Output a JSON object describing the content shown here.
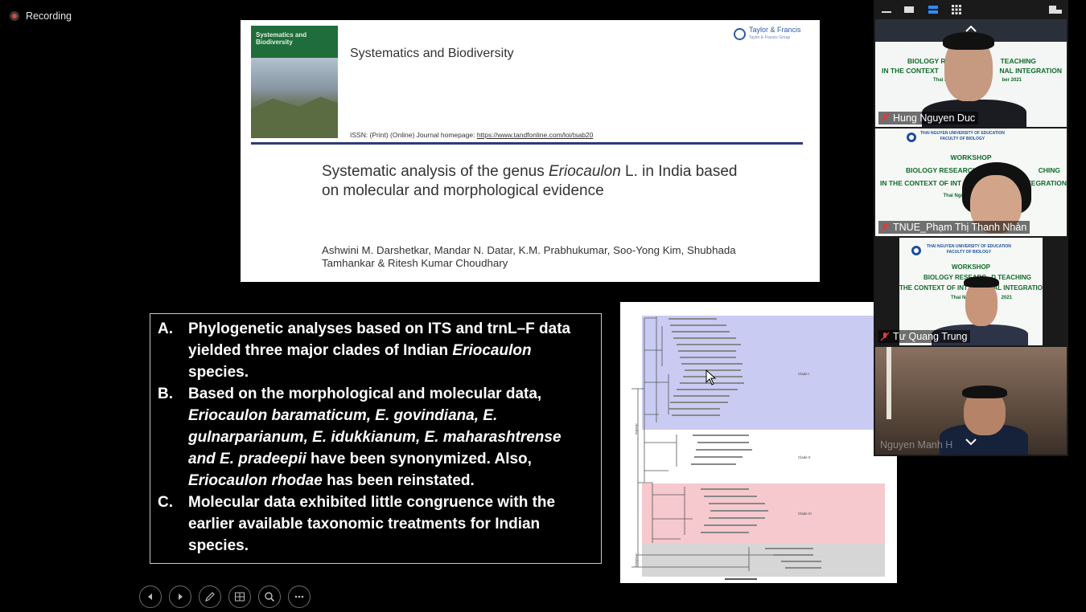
{
  "recording": {
    "label": "Recording"
  },
  "slide": {
    "cover": {
      "title": "Systematics and Biodiversity"
    },
    "journal": "Systematics and Biodiversity",
    "publisher": {
      "name": "Taylor & Francis",
      "subline": "Taylor & Francis Group"
    },
    "issn": {
      "text": "ISSN: (Print) (Online) Journal homepage:",
      "link": "https://www.tandfonline.com/loi/tsab20"
    },
    "title": {
      "part1": "Systematic analysis of the genus ",
      "italic": "Eriocaulon",
      "part2": " L. in India based on molecular and morphological evidence"
    },
    "authors": "Ashwini M. Darshetkar, Mandar N. Datar, K.M. Prabhukumar, Soo-Yong Kim, Shubhada Tamhankar & Ritesh Kumar Choudhary",
    "points": {
      "a_letter": "A.",
      "a1": "Phylogenetic analyses based on ITS and trnL–F data yielded three major clades of Indian ",
      "a_it": "Eriocaulon",
      "a2": " species.",
      "b_letter": "B.",
      "b1": "Based on the morphological and molecular data, ",
      "b_it1": "Eriocaulon baramaticum, E. govindiana, E. gulnarparianum, E. idukkianum, E. maharashtrense and E. pradeepii",
      "b2": " have been synonymized. Also, ",
      "b_it2": "Eriocaulon rhodae",
      "b3": " has been reinstated.",
      "c_letter": "C.",
      "c1": "Molecular data exhibited little congruence with the earlier available taxonomic treatments for Indian species."
    },
    "tree": {
      "clade1": "Clade I",
      "clade2": "Clade II",
      "clade3": "Clade III",
      "ingroup": "Ingroup",
      "outgroup": "Outgroup",
      "colors": {
        "clade1": "#c9cbf2",
        "clade3": "#f6c9cf",
        "outgroup": "#d6d6d6"
      }
    }
  },
  "nav": [
    "previous-icon",
    "next-icon",
    "pen-icon",
    "slides-grid-icon",
    "zoom-icon",
    "more-icon"
  ],
  "participants": [
    {
      "name": "Hung Nguyen Duc",
      "banner": [
        "BIOLOGY R",
        "TEACHING",
        "IN THE CONTEXT",
        "NAL INTEGRATION",
        "Thai N",
        "ber 2021"
      ]
    },
    {
      "name": "TNUE_Phạm Thị Thanh Nhàn",
      "banner": [
        "THAI NGUYEN UNIVERSITY OF EDUCATION",
        "FACULTY OF BIOLOGY",
        "WORKSHOP",
        "BIOLOGY RESEARCH",
        "CHING",
        "IN THE CONTEXT OF INT",
        "NTEGRATION",
        "Thai Nguy"
      ]
    },
    {
      "name": "Tư Quang Trung",
      "banner": [
        "THAI NGUYEN UNIVERSITY OF EDUCATION",
        "FACULTY OF BIOLOGY",
        "WORKSHOP",
        "BIOLOGY RESEARC",
        "D TEACHING",
        "THE CONTEXT OF INT",
        "NAL INTEGRATIO",
        "Thai Nguy",
        "2021"
      ]
    },
    {
      "name": "Nguyen Manh H"
    }
  ]
}
